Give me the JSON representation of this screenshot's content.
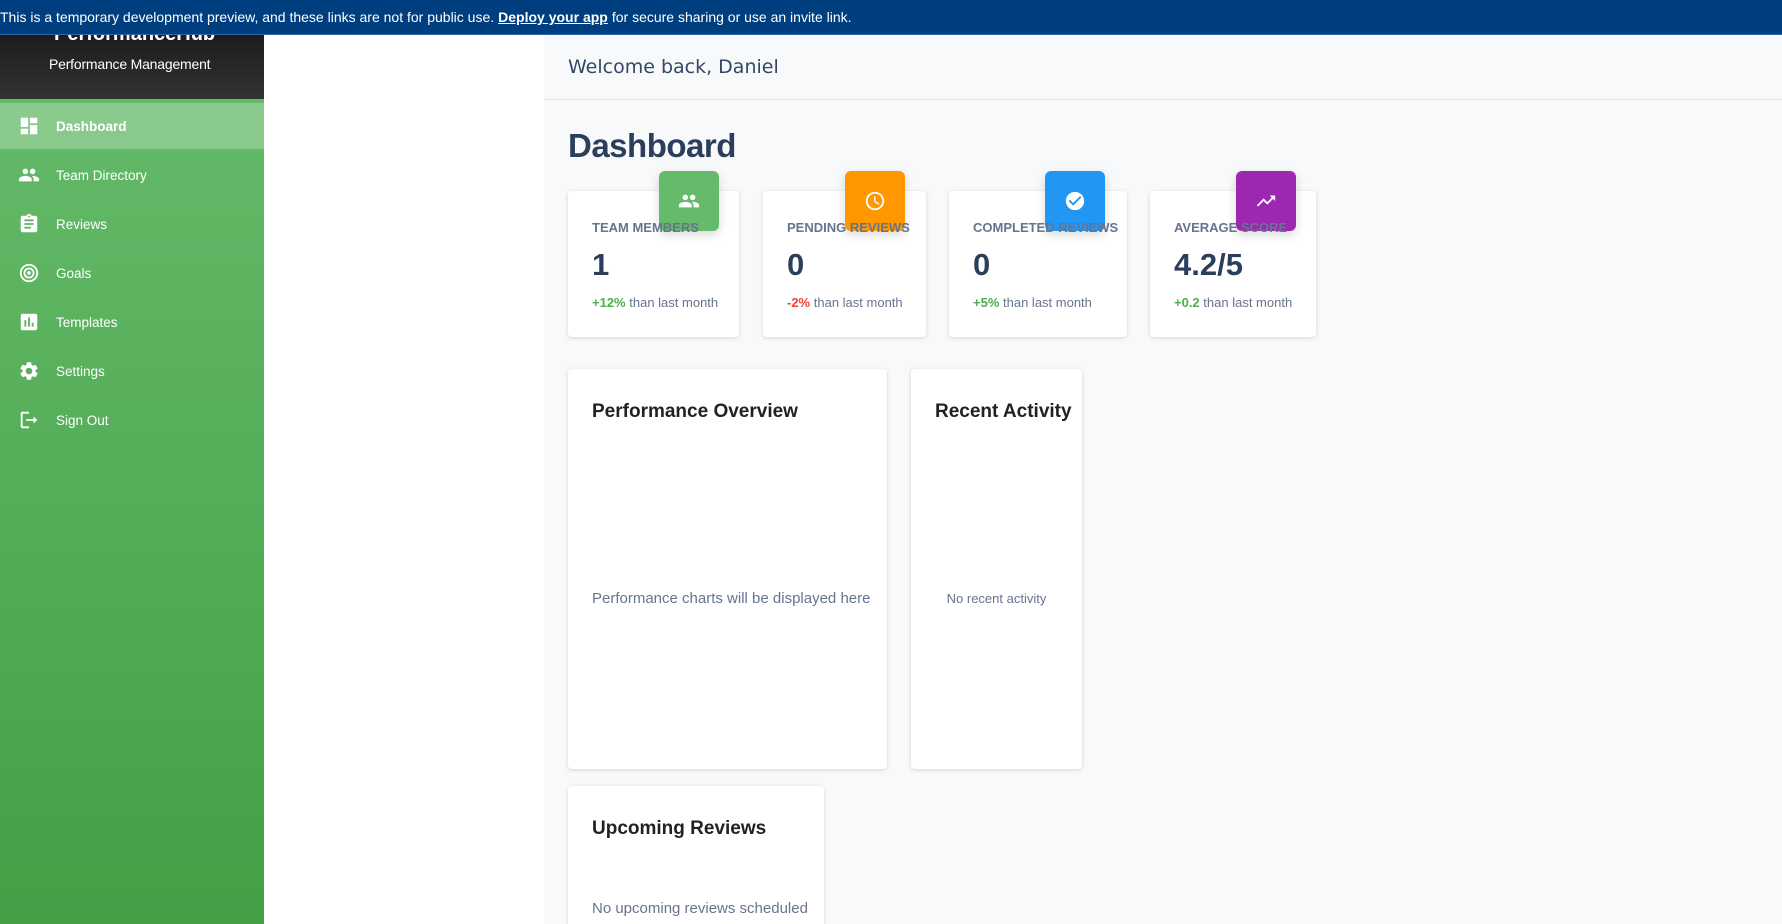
{
  "banner": {
    "text_before": "This is a temporary development preview, and these links are not for public use.",
    "link": "Deploy your app",
    "text_after": "for secure sharing or use an invite link."
  },
  "sidebar": {
    "brand_name": "PerformanceHub",
    "brand_subtitle": "Performance Management",
    "items": [
      {
        "label": "Dashboard",
        "icon": "dashboard-icon",
        "active": true
      },
      {
        "label": "Team Directory",
        "icon": "people-icon"
      },
      {
        "label": "Reviews",
        "icon": "assignment-icon"
      },
      {
        "label": "Goals",
        "icon": "target-icon"
      },
      {
        "label": "Templates",
        "icon": "bar-chart-icon"
      },
      {
        "label": "Settings",
        "icon": "gear-icon"
      },
      {
        "label": "Sign Out",
        "icon": "logout-icon"
      }
    ]
  },
  "topbar": {
    "welcome": "Welcome back, Daniel"
  },
  "page": {
    "title": "Dashboard"
  },
  "stats": [
    {
      "label": "Team Members",
      "value": "1",
      "delta": "+12%",
      "delta_suffix": "than last month",
      "color": "#66bb6a",
      "icon": "people-icon"
    },
    {
      "label": "Pending Reviews",
      "value": "0",
      "delta": "-2%",
      "delta_suffix": "than last month",
      "color": "#ff9800",
      "icon": "clock-icon"
    },
    {
      "label": "Completed Reviews",
      "value": "0",
      "delta": "+5%",
      "delta_suffix": "than last month",
      "color": "#2196f3",
      "icon": "check-circle-icon"
    },
    {
      "label": "Average Score",
      "value": "4.2/5",
      "delta": "+0.2",
      "delta_suffix": "than last month",
      "color": "#9c27b0",
      "icon": "trending-up-icon"
    }
  ],
  "panels": {
    "performance": {
      "title": "Performance Overview",
      "empty": "Performance charts will be displayed here"
    },
    "activity": {
      "title": "Recent Activity",
      "empty": "No recent activity"
    },
    "upcoming": {
      "title": "Upcoming Reviews",
      "empty": "No upcoming reviews scheduled"
    }
  }
}
